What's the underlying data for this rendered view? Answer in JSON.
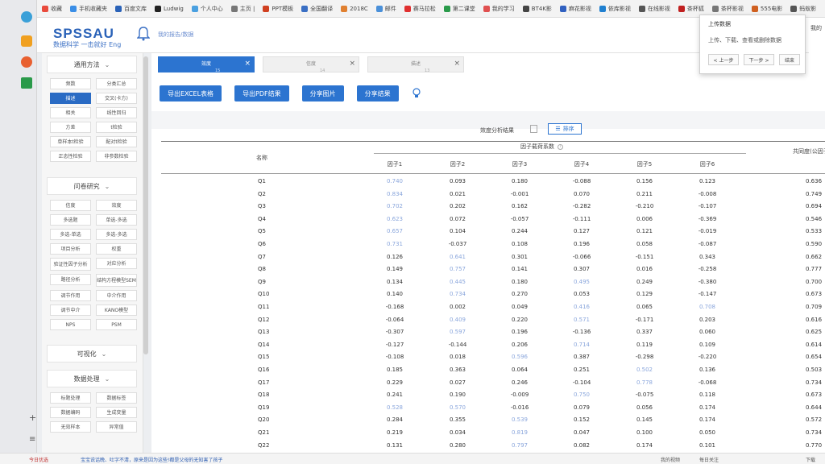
{
  "bookmarks": [
    "收藏",
    "手机收藏夹",
    "百度文库",
    "Ludwig",
    "个人中心",
    "主页 |",
    "PPT模板",
    "全国翻译",
    "2018C",
    "邮件",
    "赛马拉松",
    "第二课堂",
    "我的学习",
    "BT4K影",
    "麻花影视",
    "依库影视",
    "在线影视",
    "茶杯狐",
    "茶杯影视",
    "555电影",
    "蚂蚁影"
  ],
  "header": {
    "logo": "SPSSAU",
    "slogan": "数据科学 一击就好 Eng",
    "my_orders": "我的报告/数据"
  },
  "sidebar": {
    "sections": [
      {
        "label": "通用方法",
        "items": [
          "频数",
          "分类汇总",
          "描述",
          "交叉(卡方)",
          "相关",
          "线性回归",
          "方差",
          "t检验",
          "单样本t检验",
          "配对t检验",
          "正态性检验",
          "非参数检验"
        ]
      },
      {
        "label": "问卷研究",
        "items": [
          "信度",
          "效度",
          "多选题",
          "单选-多选",
          "多选-单选",
          "多选-多选",
          "项目分析",
          "权重",
          "验证性因子分析",
          "对应分析",
          "路径分析",
          "结构方程模型SEM",
          "调节作用",
          "中介作用",
          "调节中介",
          "KANO模型",
          "NPS",
          "PSM"
        ]
      },
      {
        "label": "可视化",
        "items": []
      },
      {
        "label": "数据处理",
        "items": [
          "标题处理",
          "数据标签",
          "数据编码",
          "生成变量",
          "无效样本",
          "异常值"
        ]
      }
    ],
    "active_item": "描述"
  },
  "tabs": [
    {
      "label": "效度",
      "count": "15",
      "active": true
    },
    {
      "label": "信度",
      "count": "14",
      "active": false
    },
    {
      "label": "描述",
      "count": "13",
      "active": false
    }
  ],
  "actions": [
    "导出EXCEL表格",
    "导出PDF结果",
    "分享图片",
    "分享结果"
  ],
  "result": {
    "title": "效度分析结果",
    "sort_label": "排序"
  },
  "table": {
    "name_header": "名称",
    "loading_header": "因子载荷系数",
    "communality_header": "共同度(公因子方差)",
    "factor_headers": [
      "因子1",
      "因子2",
      "因子3",
      "因子4",
      "因子5",
      "因子6"
    ],
    "rows": [
      {
        "name": "Q1",
        "values": [
          "0.740",
          "0.093",
          "0.180",
          "-0.088",
          "0.156",
          "0.123"
        ],
        "hl": [
          0
        ],
        "comm": "0.636"
      },
      {
        "name": "Q2",
        "values": [
          "0.834",
          "0.021",
          "-0.001",
          "0.070",
          "0.211",
          "-0.008"
        ],
        "hl": [
          0
        ],
        "comm": "0.749"
      },
      {
        "name": "Q3",
        "values": [
          "0.702",
          "0.202",
          "0.162",
          "-0.282",
          "-0.210",
          "-0.107"
        ],
        "hl": [
          0
        ],
        "comm": "0.694"
      },
      {
        "name": "Q4",
        "values": [
          "0.623",
          "0.072",
          "-0.057",
          "-0.111",
          "0.006",
          "-0.369"
        ],
        "hl": [
          0
        ],
        "comm": "0.546"
      },
      {
        "name": "Q5",
        "values": [
          "0.657",
          "0.104",
          "0.244",
          "0.127",
          "0.121",
          "-0.019"
        ],
        "hl": [
          0
        ],
        "comm": "0.533"
      },
      {
        "name": "Q6",
        "values": [
          "0.731",
          "-0.037",
          "0.108",
          "0.196",
          "0.058",
          "-0.087"
        ],
        "hl": [
          0
        ],
        "comm": "0.590"
      },
      {
        "name": "Q7",
        "values": [
          "0.126",
          "0.641",
          "0.301",
          "-0.066",
          "-0.151",
          "0.343"
        ],
        "hl": [
          1
        ],
        "comm": "0.662"
      },
      {
        "name": "Q8",
        "values": [
          "0.149",
          "0.757",
          "0.141",
          "0.307",
          "0.016",
          "-0.258"
        ],
        "hl": [
          1
        ],
        "comm": "0.777"
      },
      {
        "name": "Q9",
        "values": [
          "0.134",
          "0.445",
          "0.180",
          "0.495",
          "0.249",
          "-0.380"
        ],
        "hl": [
          1,
          3
        ],
        "comm": "0.700"
      },
      {
        "name": "Q10",
        "values": [
          "0.140",
          "0.734",
          "0.270",
          "0.053",
          "0.129",
          "-0.147"
        ],
        "hl": [
          1
        ],
        "comm": "0.673"
      },
      {
        "name": "Q11",
        "values": [
          "-0.168",
          "0.002",
          "0.049",
          "0.416",
          "0.065",
          "0.708"
        ],
        "hl": [
          3,
          5
        ],
        "comm": "0.709"
      },
      {
        "name": "Q12",
        "values": [
          "-0.064",
          "0.409",
          "0.220",
          "0.571",
          "-0.171",
          "0.203"
        ],
        "hl": [
          1,
          3
        ],
        "comm": "0.616"
      },
      {
        "name": "Q13",
        "values": [
          "-0.307",
          "0.597",
          "0.196",
          "-0.136",
          "0.337",
          "0.060"
        ],
        "hl": [
          1
        ],
        "comm": "0.625"
      },
      {
        "name": "Q14",
        "values": [
          "-0.127",
          "-0.144",
          "0.206",
          "0.714",
          "0.119",
          "0.109"
        ],
        "hl": [
          3
        ],
        "comm": "0.614"
      },
      {
        "name": "Q15",
        "values": [
          "-0.108",
          "0.018",
          "0.596",
          "0.387",
          "-0.298",
          "-0.220"
        ],
        "hl": [
          2
        ],
        "comm": "0.654"
      },
      {
        "name": "Q16",
        "values": [
          "0.185",
          "0.363",
          "0.064",
          "0.251",
          "0.502",
          "0.136"
        ],
        "hl": [
          4
        ],
        "comm": "0.503"
      },
      {
        "name": "Q17",
        "values": [
          "0.229",
          "0.027",
          "0.246",
          "-0.104",
          "0.778",
          "-0.068"
        ],
        "hl": [
          4
        ],
        "comm": "0.734"
      },
      {
        "name": "Q18",
        "values": [
          "0.241",
          "0.190",
          "-0.009",
          "0.750",
          "-0.075",
          "0.118"
        ],
        "hl": [
          3
        ],
        "comm": "0.673"
      },
      {
        "name": "Q19",
        "values": [
          "0.528",
          "0.570",
          "-0.016",
          "0.079",
          "0.056",
          "0.174"
        ],
        "hl": [
          0,
          1
        ],
        "comm": "0.644"
      },
      {
        "name": "Q20",
        "values": [
          "0.284",
          "0.355",
          "0.539",
          "0.152",
          "0.145",
          "0.174"
        ],
        "hl": [
          2
        ],
        "comm": "0.572"
      },
      {
        "name": "Q21",
        "values": [
          "0.219",
          "0.034",
          "0.819",
          "0.047",
          "0.100",
          "0.050"
        ],
        "hl": [
          2
        ],
        "comm": "0.734"
      },
      {
        "name": "Q22",
        "values": [
          "0.131",
          "0.280",
          "0.797",
          "0.082",
          "0.174",
          "0.101"
        ],
        "hl": [
          2
        ],
        "comm": "0.770"
      }
    ]
  },
  "popup": {
    "title": "上传数据",
    "desc": "上传、下载、查看或删除数据",
    "prev": "< 上一步",
    "next": "下一步 >",
    "end": "结束"
  },
  "right_edge": "我的",
  "bottom_bar": {
    "left": "今日优选",
    "ticker": "宝宝说话晚、吐字不清，原来是因为这些!都是父母的无知害了孩子",
    "items": [
      "我的视频",
      "每日关注",
      "下载"
    ]
  }
}
